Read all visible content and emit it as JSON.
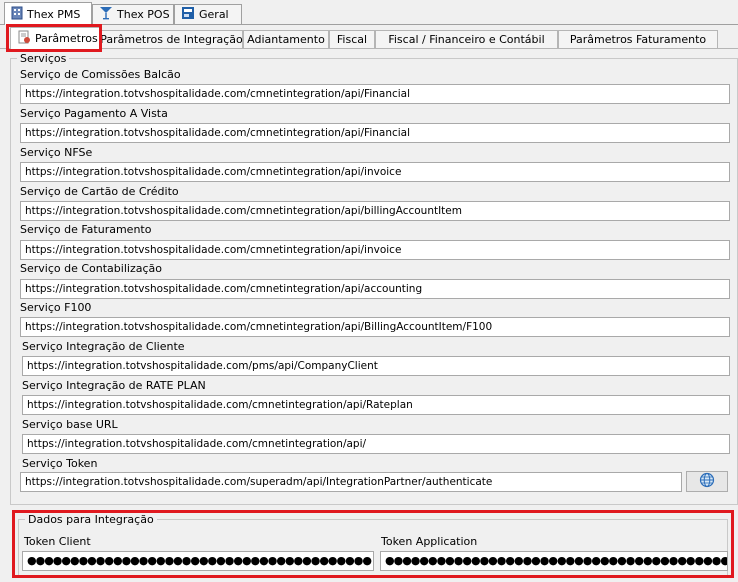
{
  "top_tabs": [
    {
      "label": "Thex PMS",
      "active": true,
      "icon": "building-icon"
    },
    {
      "label": "Thex POS",
      "active": false,
      "icon": "cocktail-icon"
    },
    {
      "label": "Geral",
      "active": false,
      "icon": "document-icon"
    }
  ],
  "sub_tabs": [
    {
      "label": "Parâmetros",
      "active": true
    },
    {
      "label": "Parâmetros de Integração"
    },
    {
      "label": "Adiantamento"
    },
    {
      "label": "Fiscal"
    },
    {
      "label": "Fiscal / Financeiro e Contábil"
    },
    {
      "label": "Parâmetros Faturamento"
    }
  ],
  "servicos": {
    "legend": "Serviços",
    "fields": [
      {
        "label": "Serviço de Comissões Balcão",
        "value": "https://integration.totvshospitalidade.com/cmnetintegration/api/Financial"
      },
      {
        "label": "Serviço Pagamento A Vista",
        "value": "https://integration.totvshospitalidade.com/cmnetintegration/api/Financial"
      },
      {
        "label": "Serviço NFSe",
        "value": "https://integration.totvshospitalidade.com/cmnetintegration/api/invoice"
      },
      {
        "label": "Serviço de Cartão de Crédito",
        "value": "https://integration.totvshospitalidade.com/cmnetintegration/api/billingAccountItem"
      },
      {
        "label": "Serviço de Faturamento",
        "value": "https://integration.totvshospitalidade.com/cmnetintegration/api/invoice"
      },
      {
        "label": "Serviço de Contabilização",
        "value": "https://integration.totvshospitalidade.com/cmnetintegration/api/accounting"
      },
      {
        "label": "Serviço F100",
        "value": "https://integration.totvshospitalidade.com/cmnetintegration/api/BillingAccountItem/F100"
      },
      {
        "label": "Serviço Integração de Cliente",
        "value": "https://integration.totvshospitalidade.com/pms/api/CompanyClient"
      },
      {
        "label": "Serviço Integração de RATE PLAN",
        "value": "https://integration.totvshospitalidade.com/cmnetintegration/api/Rateplan"
      },
      {
        "label": "Serviço base URL",
        "value": "https://integration.totvshospitalidade.com/cmnetintegration/api/"
      },
      {
        "label": "Serviço Token",
        "value": "https://integration.totvshospitalidade.com/superadm/api/IntegrationPartner/authenticate"
      }
    ],
    "token_button_icon": "globe-icon"
  },
  "integracao": {
    "legend": "Dados para Integração",
    "token_client_label": "Token Client",
    "token_client_value": "●●●●●●●●●●●●●●●●●●●●●●●●●●●●●●●●●●●●●●●●",
    "token_application_label": "Token Application",
    "token_application_value": "●●●●●●●●●●●●●●●●●●●●●●●●●●●●●●●●●●●●●●●●"
  }
}
